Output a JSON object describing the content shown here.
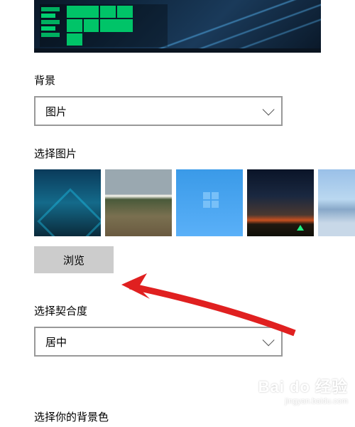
{
  "sections": {
    "background": {
      "label": "背景",
      "selected": "图片"
    },
    "choose_picture": {
      "label": "选择图片",
      "browse_button": "浏览"
    },
    "choose_fit": {
      "label": "选择契合度",
      "selected": "居中"
    },
    "bottom_cut": "选择你的背景色"
  },
  "thumbnails": [
    {
      "name": "architecture-teal"
    },
    {
      "name": "mountain-landscape"
    },
    {
      "name": "windows-blue"
    },
    {
      "name": "night-sky-tent"
    },
    {
      "name": "beach-reflection"
    }
  ],
  "watermark": {
    "brand": "Bai do 经验",
    "url": "jingyan.baidu.com"
  }
}
